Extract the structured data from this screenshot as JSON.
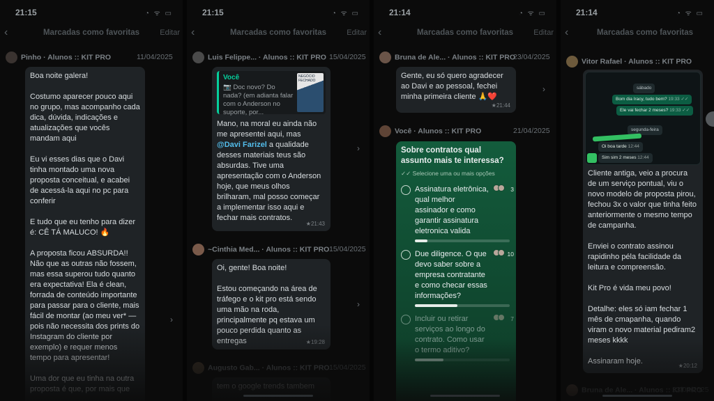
{
  "status": {
    "time": "21:15",
    "time_alt": "21:14",
    "icons": "◔ ᯤ ▭"
  },
  "header": {
    "title": "Marcadas como favoritas",
    "edit": "Editar",
    "back": "‹"
  },
  "panels": [
    {
      "messages": [
        {
          "sender": "Pinho · Alunos :: KIT PRO",
          "date": "11/04/2025",
          "paragraphs": [
            "Boa noite galera!",
            "Costumo aparecer pouco aqui no grupo, mas acompanho cada dica, dúvida, indicações e atualizações que vocês mandam aqui",
            "Eu vi esses dias que o Davi tinha montado uma nova proposta conceitual, e acabei de acessá-la aqui no pc para conferir",
            "E tudo que eu tenho para dizer é: CÊ TÁ MALUCO! 🔥",
            "A proposta ficou ABSURDA!! Não que as outras não fossem, mas essa superou tudo quanto era expectativa! Ela é clean, forrada de conteúdo importante para passar para o cliente, mais fácil de montar (ao meu ver* — pois não necessita dos prints do Instagram do cliente por exemplo) e requer menos tempo para apresentar!",
            "Uma dor que eu tinha na outra proposta é que, por mais que"
          ]
        }
      ]
    },
    {
      "messages": [
        {
          "sender": "Luis Felippe... · Alunos :: KIT PRO",
          "date": "15/04/2025",
          "quote_name": "Você",
          "quote_text": "📷 Doc novo? Do nada? (em adianta falar com o Anderson no suporte, por...",
          "quote_thumb": "NEGÓCIO FECHADO",
          "text_before": "Mano, na moral eu ainda não me apresentei aqui, mas ",
          "mention": "@Davi Farizel",
          "text_after": " a qualidade desses materiais teus são absurdas. Tive uma apresentação com o Anderson hoje, que meus olhos brilharam, mal posso começar a implementar isso aqui e fechar mais contratos.",
          "time": "★21:43"
        },
        {
          "sender": "~Cinthia Med... · Alunos :: KIT PRO",
          "date": "15/04/2025",
          "paragraphs": [
            "Oi, gente! Boa noite!",
            "Estou começando na área de tráfego e o kit pro está sendo uma mão na roda, principalmente pq estava um pouco perdida quanto as entregas"
          ],
          "time": "★19:28"
        },
        {
          "sender": "Augusto Gab... · Alunos :: KIT PRO",
          "date": "15/04/2025",
          "paragraphs": [
            "tem o google trends tambem"
          ]
        }
      ]
    },
    {
      "messages": [
        {
          "sender": "Bruna de Ale... · Alunos :: KIT PRO",
          "date": "23/04/2025",
          "paragraphs": [
            "Gente, eu só quero agradecer ao Davi e ao pessoal, fechei minha primeira cliente 🙏❤️"
          ],
          "time": "★21:44"
        },
        {
          "sender": "Você · Alunos :: KIT PRO",
          "date": "21/04/2025",
          "poll_question": "Sobre contratos qual assunto mais te interessa?",
          "poll_hint": "✓✓ Selecione uma ou mais opções",
          "options": [
            {
              "text": "Assinatura eletrônica, qual melhor assinador e como garantir assinatura eletronica valida",
              "count": "3",
              "fraction": 0.13
            },
            {
              "text": "Due diligence. O que devo saber sobre a empresa contratante e como checar essas informações?",
              "count": "10",
              "fraction": 0.45
            },
            {
              "text": "Incluir ou retirar serviços ao longo do contrato. Como usar o termo aditivo?",
              "count": "7",
              "fraction": 0.3
            }
          ]
        }
      ]
    },
    {
      "messages": [
        {
          "sender": "Vitor Rafael · Alunos :: KIT PRO",
          "date": "",
          "screenshot": {
            "day1": "sábado",
            "m1": "Bom dia Iracy, tudo bem?",
            "m1_time": "19:33 ✓✓",
            "m2": "Ele vai fechar 2 meses?",
            "m2_time": "19:33 ✓✓",
            "day2": "segunda-feira",
            "m3": "Oi boa tarde",
            "m3_time": "12:44",
            "m4": "Sim sim 2 meses",
            "m4_time": "12:44"
          },
          "paragraphs": [
            "Cliente antiga, veio a procura de um serviço pontual, viu o novo modelo de proposta pirou, fechou 3x o valor que tinha feito anteriormente o mesmo tempo de campanha.",
            "Enviei o contrato assinou rapidinho péla facilidade da leitura e compreensão.",
            "Kit Pro é vida meu povo!",
            "Detalhe: eles só iam fechar 1 mês de cmapanha, quando viram o novo material pediram2 meses kkkk",
            "Assinaram hoje."
          ],
          "time": "★20:12"
        },
        {
          "sender": "Bruna de Ale... · Alunos :: KIT PRO",
          "date": "23/04/2025"
        }
      ]
    }
  ],
  "colors": {
    "background": "#0b0b0b",
    "bubble": "#1f2326",
    "poll_top": "#135c3c",
    "accent": "#06cf9c",
    "mention": "#53bdeb"
  }
}
